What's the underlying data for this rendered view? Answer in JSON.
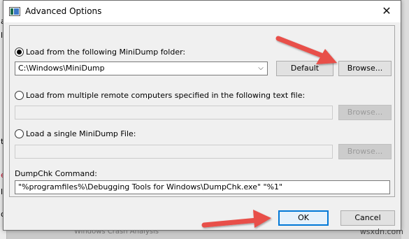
{
  "dialog": {
    "title": "Advanced Options",
    "close_glyph": "✕"
  },
  "options": {
    "folder": {
      "label": "Load from the following MiniDump folder:",
      "selected": true,
      "value": "C:\\Windows\\MiniDump",
      "default_button": "Default",
      "browse_button": "Browse..."
    },
    "remote": {
      "label": "Load from multiple remote computers specified in the following text file:",
      "selected": false,
      "value": "",
      "browse_button": "Browse..."
    },
    "single": {
      "label": "Load a single MiniDump File:",
      "selected": false,
      "value": "",
      "browse_button": "Browse..."
    }
  },
  "dumpchk": {
    "label": "DumpChk Command:",
    "value": "\"%programfiles%\\Debugging Tools for Windows\\DumpChk.exe\" \"%1\""
  },
  "buttons": {
    "ok": "OK",
    "cancel": "Cancel"
  },
  "background": {
    "left_glyphs": [
      "a",
      "le",
      "ty",
      "l",
      "o"
    ],
    "red_glyph": "e",
    "bottom_text": "Windows Crash Analysis"
  },
  "watermark": "wsxdn.com",
  "colors": {
    "accent": "#0078d7",
    "arrow": "#e8504a"
  }
}
